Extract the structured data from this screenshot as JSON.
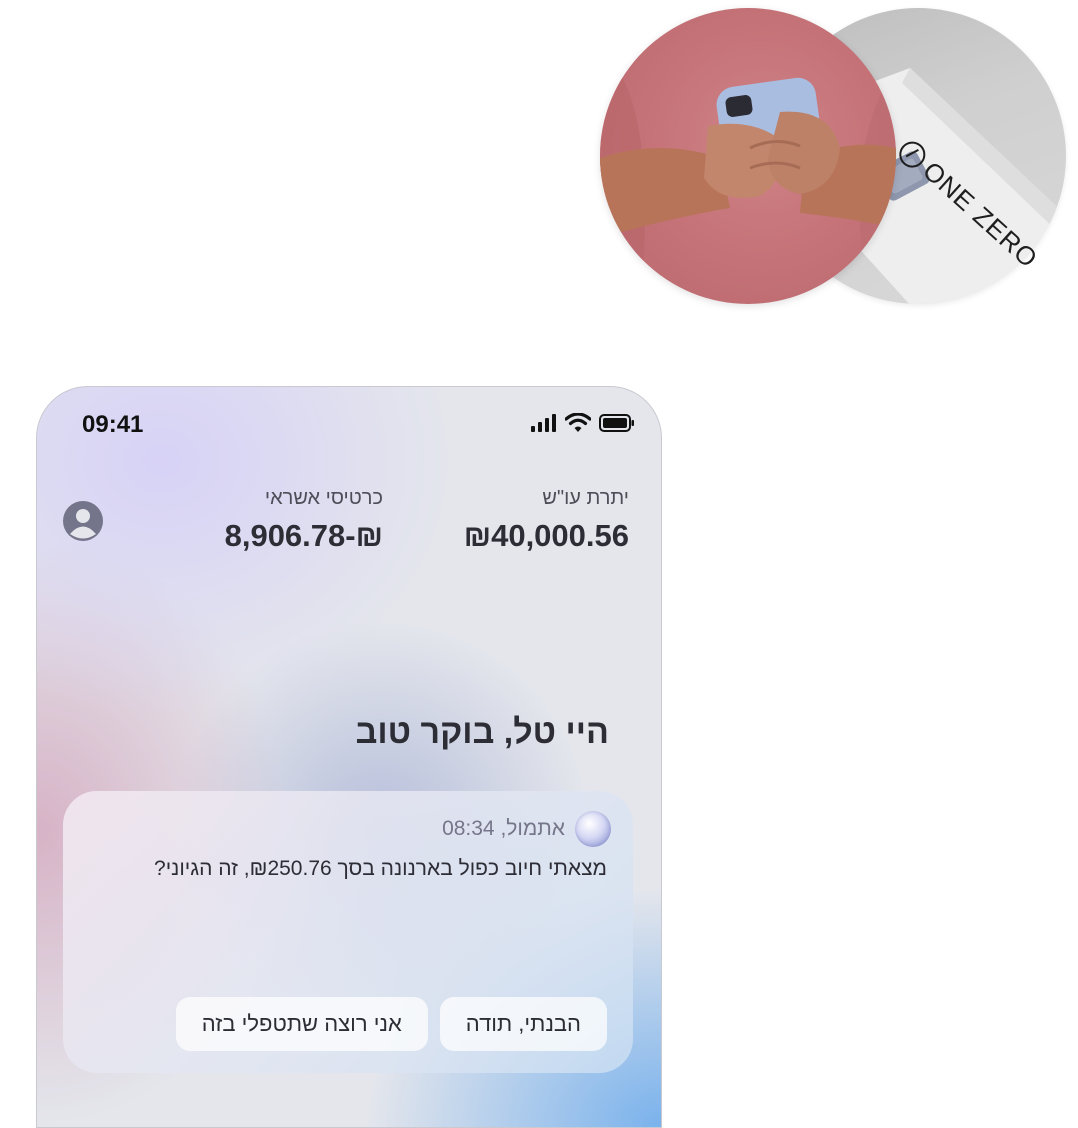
{
  "hero": {
    "card_brand": "ONE ZERO",
    "photo_person": "person-holding-phone-photo",
    "photo_card": "credit-card-photo"
  },
  "status_bar": {
    "time": "09:41",
    "icons": [
      "signal-icon",
      "wifi-icon",
      "battery-icon"
    ]
  },
  "balances": {
    "checking": {
      "label": "יתרת עו\"ש",
      "amount": "₪40,000.56"
    },
    "credit_cards": {
      "label": "כרטיסי אשראי",
      "amount": "₪-8,906.78"
    }
  },
  "greeting": "היי טל, בוקר טוב",
  "message": {
    "time": "אתמול, 08:34",
    "text": "מצאתי חיוב כפול בארנונה בסך ₪250.76, זה הגיוני?",
    "actions": {
      "acknowledge": "הבנתי, תודה",
      "handle": "אני רוצה שתטפלי בזה"
    }
  },
  "colors": {
    "text_dark": "#2d2d36",
    "text_muted": "#76768a",
    "accent_blue": "#7ab2ec",
    "accent_lavender": "#d6d1f7"
  }
}
